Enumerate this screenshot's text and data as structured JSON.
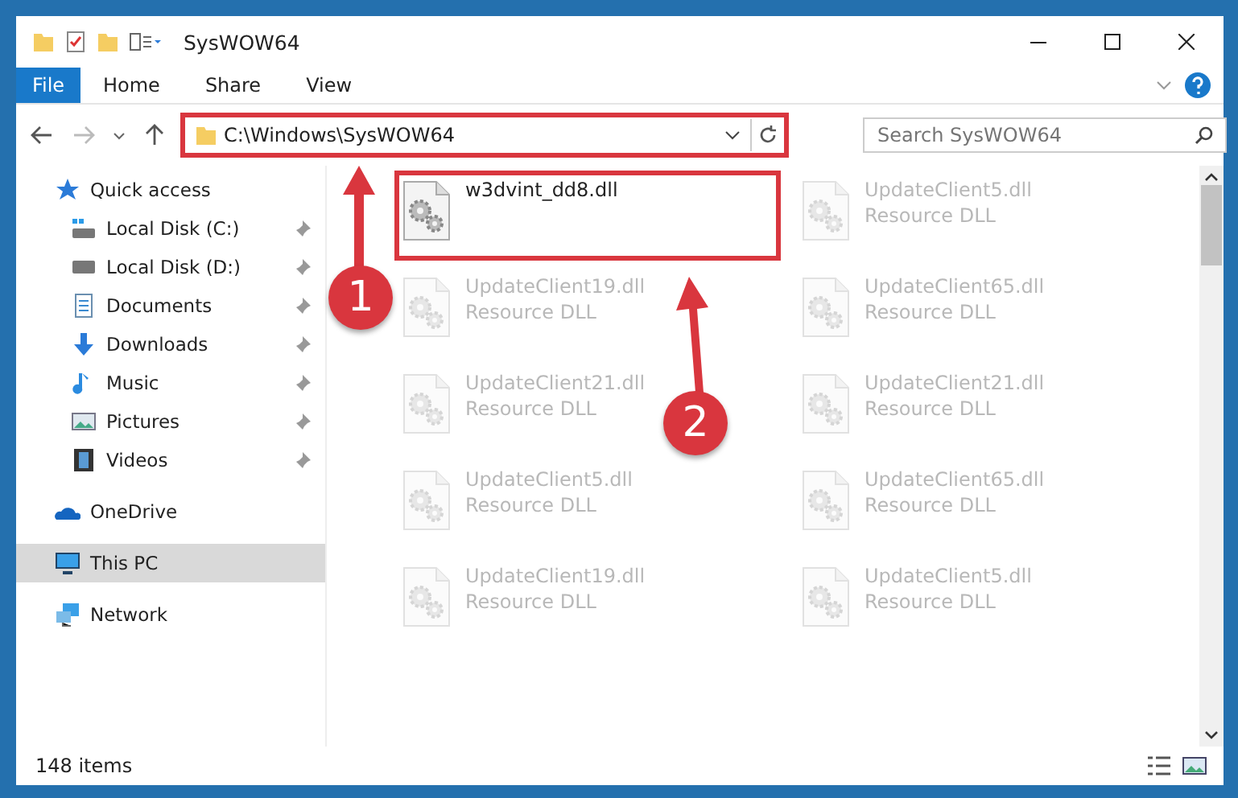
{
  "window": {
    "title": "SysWOW64"
  },
  "ribbon": {
    "file_tab": "File",
    "tabs": [
      {
        "label": "Home",
        "selected": false
      },
      {
        "label": "Share",
        "selected": false
      },
      {
        "label": "View",
        "selected": false
      }
    ]
  },
  "address_bar": {
    "path": "C:\\Windows\\SysWOW64",
    "highlighted": true,
    "search_placeholder": "Search SysWOW64"
  },
  "sidebar": {
    "items": [
      {
        "label": "Quick access",
        "kind": "star",
        "selected": false,
        "children": [
          {
            "label": "Local Disk (C:)",
            "kind": "disk-c",
            "pinned": true
          },
          {
            "label": "Local Disk (D:)",
            "kind": "disk",
            "pinned": true
          },
          {
            "label": "Documents",
            "kind": "docs",
            "pinned": true
          },
          {
            "label": "Downloads",
            "kind": "download",
            "pinned": true
          },
          {
            "label": "Music",
            "kind": "music",
            "pinned": true
          },
          {
            "label": "Pictures",
            "kind": "pictures",
            "pinned": true
          },
          {
            "label": "Videos",
            "kind": "videos",
            "pinned": true
          }
        ]
      },
      {
        "label": "OneDrive",
        "kind": "cloud",
        "selected": false
      },
      {
        "label": "This PC",
        "kind": "pc",
        "selected": true
      },
      {
        "label": "Network",
        "kind": "network",
        "selected": false
      }
    ]
  },
  "files": [
    {
      "name": "w3dvint_dd8.dll",
      "selected": true,
      "highlighted": true
    },
    {
      "name": "UpdateClient5.dll",
      "type": "Resource DLL",
      "selected": false,
      "highlighted": false
    },
    {
      "name": "UpdateClient19.dll",
      "type": "Resource DLL",
      "selected": false,
      "highlighted": false
    },
    {
      "name": "UpdateClient65.dll",
      "type": "Resource DLL",
      "selected": false,
      "highlighted": false
    },
    {
      "name": "UpdateClient21.dll",
      "type": "Resource DLL",
      "selected": false,
      "highlighted": false
    },
    {
      "name": "UpdateClient21.dll",
      "type": "Resource DLL",
      "selected": false,
      "highlighted": false
    },
    {
      "name": "UpdateClient5.dll",
      "type": "Resource DLL",
      "selected": false,
      "highlighted": false
    },
    {
      "name": "UpdateClient65.dll",
      "type": "Resource DLL",
      "selected": false,
      "highlighted": false
    },
    {
      "name": "UpdateClient19.dll",
      "type": "Resource DLL",
      "selected": false,
      "highlighted": false
    },
    {
      "name": "UpdateClient5.dll",
      "type": "Resource DLL",
      "selected": false,
      "highlighted": false
    }
  ],
  "status_bar": {
    "item_count": "148 items"
  },
  "annotations": [
    {
      "number": "1"
    },
    {
      "number": "2"
    }
  ]
}
